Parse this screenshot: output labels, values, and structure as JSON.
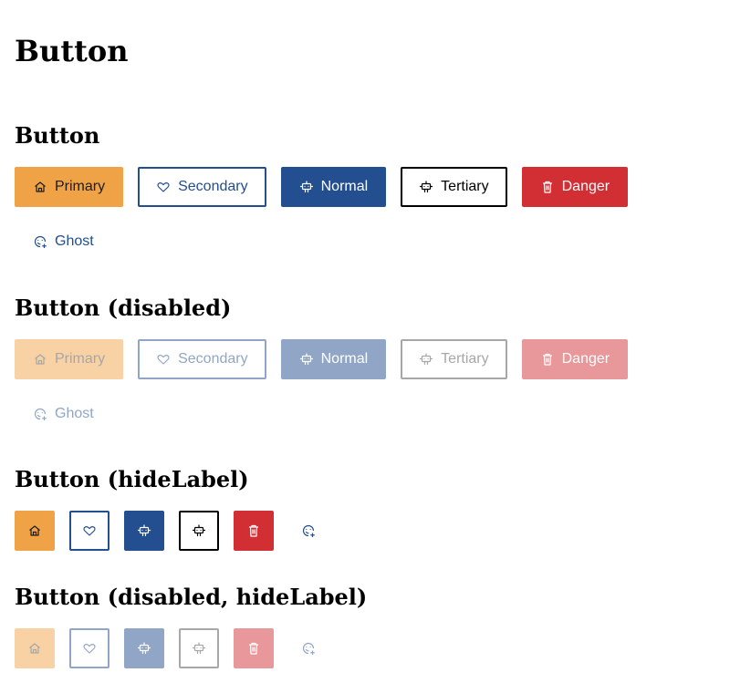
{
  "page_title": "Button",
  "sections": {
    "normal": {
      "heading": "Button"
    },
    "disabled": {
      "heading": "Button (disabled)"
    },
    "hide_label": {
      "heading": "Button (hideLabel)"
    },
    "disabled_hide_label": {
      "heading": "Button (disabled, hideLabel)"
    }
  },
  "buttons": {
    "primary": {
      "label": "Primary",
      "icon": "home-icon"
    },
    "secondary": {
      "label": "Secondary",
      "icon": "heart-icon"
    },
    "normal": {
      "label": "Normal",
      "icon": "robot-icon"
    },
    "tertiary": {
      "label": "Tertiary",
      "icon": "robot-icon"
    },
    "danger": {
      "label": "Danger",
      "icon": "trash-icon"
    },
    "ghost": {
      "label": "Ghost",
      "icon": "face-add-icon"
    }
  },
  "colors": {
    "primary": "#f0a246",
    "normal": "#234e8f",
    "danger": "#d22f34",
    "tertiary": "#000000"
  }
}
